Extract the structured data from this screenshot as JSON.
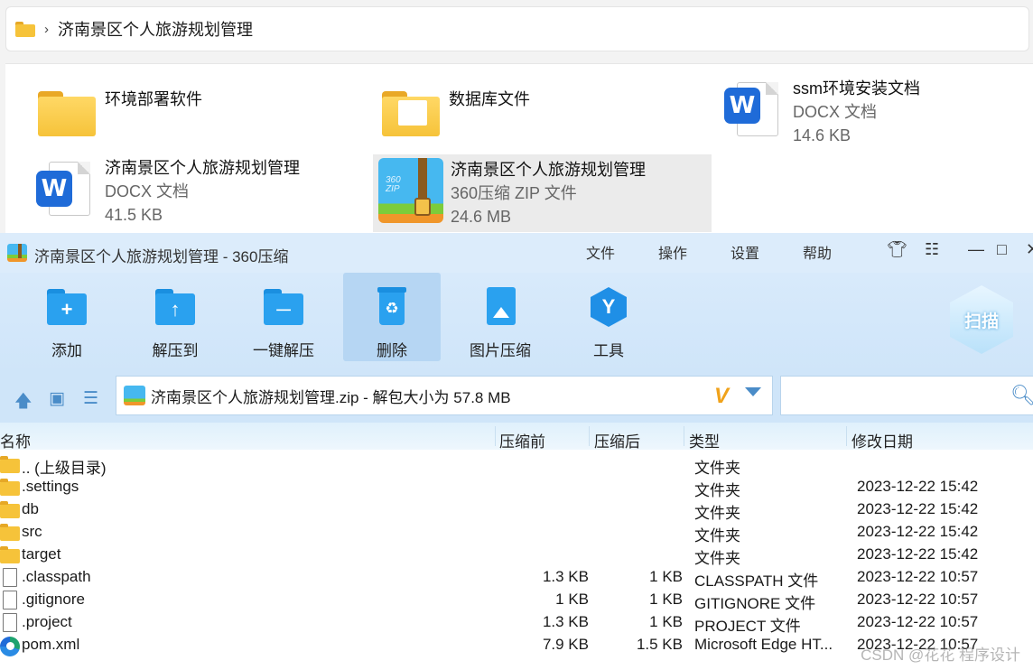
{
  "explorer": {
    "breadcrumb": "济南景区个人旅游规划管理",
    "items": [
      {
        "name": "环境部署软件",
        "sub1": "",
        "sub2": "",
        "icon": "folder-icon"
      },
      {
        "name": "数据库文件",
        "sub1": "",
        "sub2": "",
        "icon": "folder-with-document-icon"
      },
      {
        "name": "ssm环境安装文档",
        "sub1": "DOCX 文档",
        "sub2": "14.6 KB",
        "icon": "word-document-icon"
      },
      {
        "name": "济南景区个人旅游规划管理",
        "sub1": "DOCX 文档",
        "sub2": "41.5 KB",
        "icon": "word-document-icon"
      },
      {
        "name": "济南景区个人旅游规划管理",
        "sub1": "360压缩 ZIP 文件",
        "sub2": "24.6 MB",
        "icon": "zip-archive-icon",
        "selected": true
      }
    ]
  },
  "zipwin": {
    "title": "济南景区个人旅游规划管理 - 360压缩",
    "menu": [
      "文件",
      "操作",
      "设置",
      "帮助"
    ],
    "toolbar": [
      "添加",
      "解压到",
      "一键解压",
      "删除",
      "图片压缩",
      "工具"
    ],
    "scan_label": "扫描",
    "path": "济南景区个人旅游规划管理.zip - 解包大小为 57.8 MB",
    "search_placeholder": "",
    "columns": {
      "name": "名称",
      "before": "压缩前",
      "after": "压缩后",
      "type": "类型",
      "date": "修改日期"
    },
    "rows": [
      {
        "name": ".. (上级目录)",
        "before": "",
        "after": "",
        "type": "文件夹",
        "date": "",
        "icon": "folder"
      },
      {
        "name": ".settings",
        "before": "",
        "after": "",
        "type": "文件夹",
        "date": "2023-12-22 15:42",
        "icon": "folder"
      },
      {
        "name": "db",
        "before": "",
        "after": "",
        "type": "文件夹",
        "date": "2023-12-22 15:42",
        "icon": "folder"
      },
      {
        "name": "src",
        "before": "",
        "after": "",
        "type": "文件夹",
        "date": "2023-12-22 15:42",
        "icon": "folder"
      },
      {
        "name": "target",
        "before": "",
        "after": "",
        "type": "文件夹",
        "date": "2023-12-22 15:42",
        "icon": "folder"
      },
      {
        "name": ".classpath",
        "before": "1.3 KB",
        "after": "1 KB",
        "type": "CLASSPATH 文件",
        "date": "2023-12-22 10:57",
        "icon": "file"
      },
      {
        "name": ".gitignore",
        "before": "1 KB",
        "after": "1 KB",
        "type": "GITIGNORE 文件",
        "date": "2023-12-22 10:57",
        "icon": "file"
      },
      {
        "name": ".project",
        "before": "1.3 KB",
        "after": "1 KB",
        "type": "PROJECT 文件",
        "date": "2023-12-22 10:57",
        "icon": "file"
      },
      {
        "name": "pom.xml",
        "before": "7.9 KB",
        "after": "1.5 KB",
        "type": "Microsoft Edge HT...",
        "date": "2023-12-22 10:57",
        "icon": "edge"
      }
    ]
  },
  "watermark": "CSDN @花花 程序设计"
}
